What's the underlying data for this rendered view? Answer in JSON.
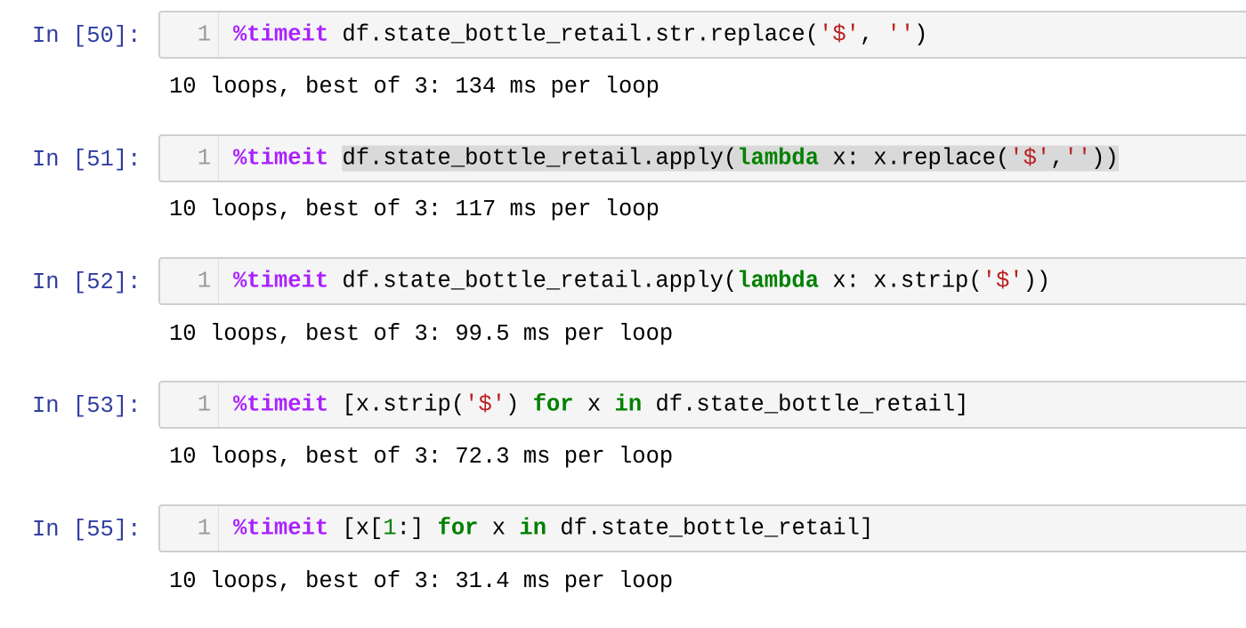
{
  "cells": [
    {
      "prompt": "In [50]:",
      "line_number": "1",
      "code_tokens": [
        {
          "text": "%timeit",
          "type": "magic"
        },
        {
          "text": " df.state_bottle_retail.str.replace(",
          "type": "plain"
        },
        {
          "text": "'$'",
          "type": "str"
        },
        {
          "text": ", ",
          "type": "plain"
        },
        {
          "text": "''",
          "type": "str"
        },
        {
          "text": ")",
          "type": "plain"
        }
      ],
      "output": "10 loops, best of 3: 134 ms per loop"
    },
    {
      "prompt": "In [51]:",
      "line_number": "1",
      "selected": true,
      "code_tokens": [
        {
          "text": "%timeit",
          "type": "magic"
        },
        {
          "text": " ",
          "type": "plain"
        },
        {
          "text": "df.state_bottle_retail.apply(",
          "type": "plain",
          "sel": true
        },
        {
          "text": "lambda",
          "type": "kw",
          "sel": true
        },
        {
          "text": " x: x.replace(",
          "type": "plain",
          "sel": true
        },
        {
          "text": "'$'",
          "type": "str",
          "sel": true
        },
        {
          "text": ",",
          "type": "plain",
          "sel": true
        },
        {
          "text": "''",
          "type": "str",
          "sel": true
        },
        {
          "text": "))",
          "type": "plain",
          "sel": true
        }
      ],
      "output": "10 loops, best of 3: 117 ms per loop"
    },
    {
      "prompt": "In [52]:",
      "line_number": "1",
      "code_tokens": [
        {
          "text": "%timeit",
          "type": "magic"
        },
        {
          "text": " df.state_bottle_retail.apply(",
          "type": "plain"
        },
        {
          "text": "lambda",
          "type": "kw"
        },
        {
          "text": " x: x.strip(",
          "type": "plain"
        },
        {
          "text": "'$'",
          "type": "str"
        },
        {
          "text": "))",
          "type": "plain"
        }
      ],
      "output": "10 loops, best of 3: 99.5 ms per loop"
    },
    {
      "prompt": "In [53]:",
      "line_number": "1",
      "code_tokens": [
        {
          "text": "%timeit",
          "type": "magic"
        },
        {
          "text": " [x.strip(",
          "type": "plain"
        },
        {
          "text": "'$'",
          "type": "str"
        },
        {
          "text": ") ",
          "type": "plain"
        },
        {
          "text": "for",
          "type": "kw"
        },
        {
          "text": " x ",
          "type": "plain"
        },
        {
          "text": "in",
          "type": "kw"
        },
        {
          "text": " df.state_bottle_retail]",
          "type": "plain"
        }
      ],
      "output": "10 loops, best of 3: 72.3 ms per loop"
    },
    {
      "prompt": "In [55]:",
      "line_number": "1",
      "code_tokens": [
        {
          "text": "%timeit",
          "type": "magic"
        },
        {
          "text": " [x[",
          "type": "plain"
        },
        {
          "text": "1",
          "type": "num"
        },
        {
          "text": ":] ",
          "type": "plain"
        },
        {
          "text": "for",
          "type": "kw"
        },
        {
          "text": " x ",
          "type": "plain"
        },
        {
          "text": "in",
          "type": "kw"
        },
        {
          "text": " df.state_bottle_retail]",
          "type": "plain"
        }
      ],
      "output": "10 loops, best of 3: 31.4 ms per loop"
    }
  ],
  "colors": {
    "prompt": "#303f9f",
    "magic": "#aa22ff",
    "keyword": "#008000",
    "string": "#ba2121",
    "cell_background": "#f5f5f5",
    "selection": "#d9d9d9"
  }
}
